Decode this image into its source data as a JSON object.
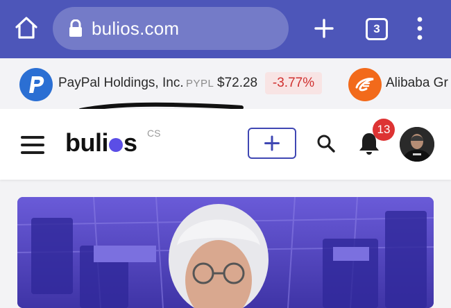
{
  "browser": {
    "url": "bulios.com",
    "tab_count": "3",
    "icons": {
      "home": "home-icon",
      "lock": "lock-icon",
      "new_tab": "plus-icon",
      "menu": "more-vertical-icon"
    },
    "toolbar_color": "#4d56b9"
  },
  "ticker": {
    "items": [
      {
        "logo": "paypal-logo",
        "name": "PayPal Holdings, Inc.",
        "symbol": "PYPL",
        "price": "$72.28",
        "change": "-3.77%",
        "change_color": "#d0302f"
      },
      {
        "logo": "alibaba-logo",
        "name": "Alibaba Gr"
      }
    ]
  },
  "header": {
    "logo_text_left": "buli",
    "logo_text_right": "s",
    "language": "CS",
    "notification_count": "13",
    "brand_color": "#5b4ee6",
    "icons": {
      "menu": "hamburger-icon",
      "add": "plus-icon",
      "search": "search-icon",
      "notifications": "bell-icon",
      "profile": "avatar"
    }
  },
  "content": {
    "hero_image": "article-hero-image"
  }
}
